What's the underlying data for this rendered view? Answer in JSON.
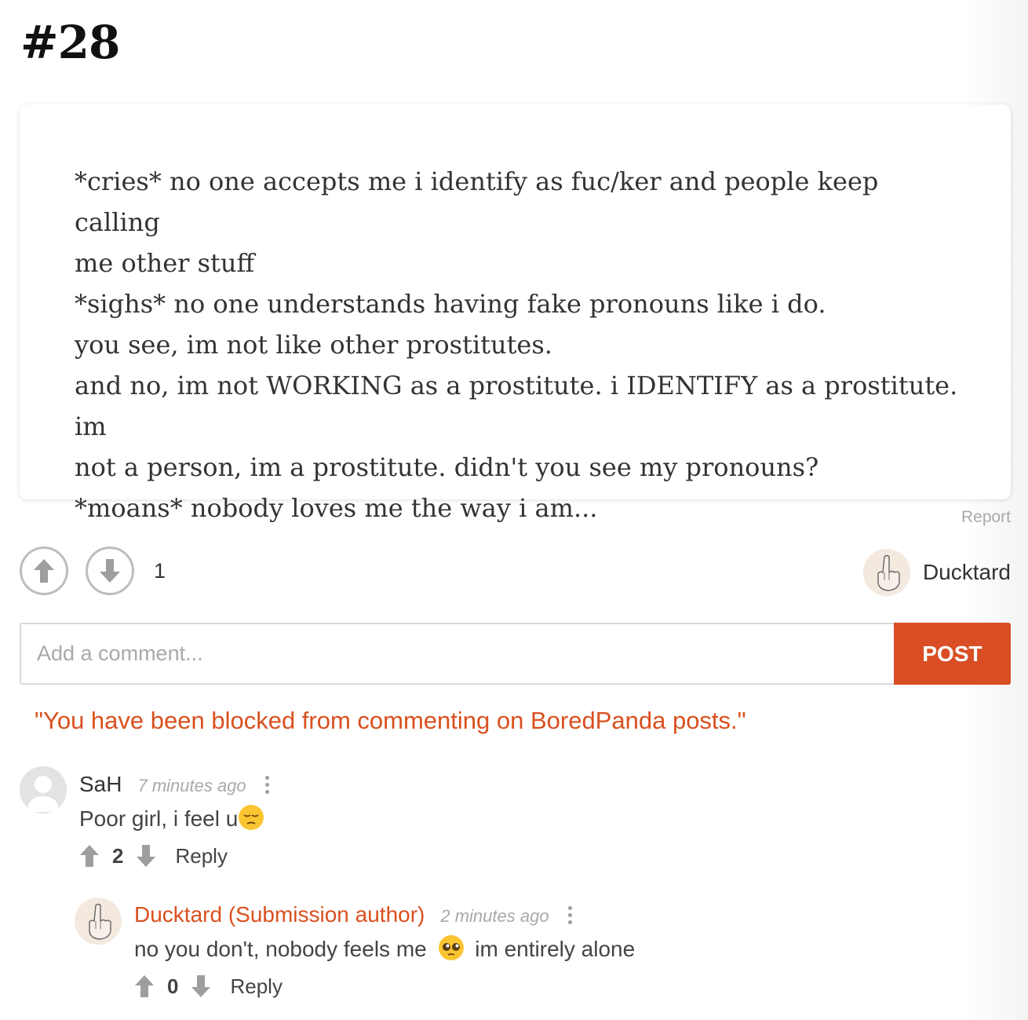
{
  "post": {
    "number": "#28",
    "text_lines": [
      "*cries* no one accepts me i identify as fuc/ker and people keep calling",
      "me other stuff",
      "*sighs* no one understands having fake pronouns like i do.",
      "you see, im not like other prostitutes.",
      "and no, im not WORKING as a prostitute. i IDENTIFY as a prostitute. im",
      "not a person, im a prostitute. didn't you see my pronouns?",
      "*moans* nobody loves me the way i am..."
    ],
    "report_label": "Report",
    "vote_count": "1",
    "author": "Ducktard"
  },
  "comment_form": {
    "placeholder": "Add a comment...",
    "post_label": "POST"
  },
  "blocked_notice": "\"You have been blocked from commenting on BoredPanda posts.\"",
  "comments": [
    {
      "user": "SaH",
      "time": "7 minutes ago",
      "text": "Poor girl, i feel u",
      "votes": "2",
      "reply_label": "Reply"
    },
    {
      "user": "Ducktard (Submission author)",
      "time": "2 minutes ago",
      "text_before": "no you don't, nobody feels me",
      "text_after": "im entirely alone",
      "votes": "0",
      "reply_label": "Reply"
    }
  ],
  "colors": {
    "accent": "#d94e24",
    "muted": "#a9a9a9",
    "text": "#333333"
  },
  "icons": [
    "upvote-arrow-icon",
    "downvote-arrow-icon",
    "kebab-menu-icon",
    "middle-finger-avatar",
    "default-user-avatar",
    "pensive-face-emoji",
    "pleading-face-emoji"
  ]
}
